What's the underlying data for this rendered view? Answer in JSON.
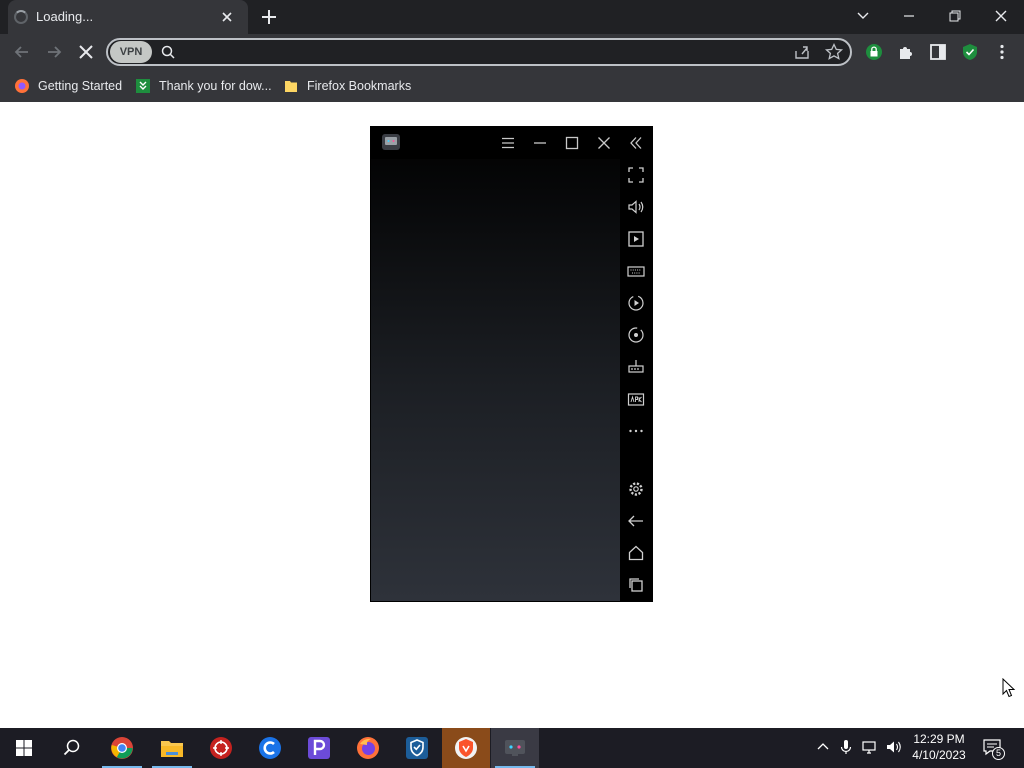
{
  "browser": {
    "tab_title": "Loading...",
    "vpn_label": "VPN",
    "omnibox_placeholder": "",
    "bookmarks": [
      {
        "label": "Getting Started",
        "icon": "firefox-icon"
      },
      {
        "label": "Thank you for dow...",
        "icon": "download-site-icon"
      },
      {
        "label": "Firefox Bookmarks",
        "icon": "folder-icon"
      }
    ],
    "colors": {
      "frame": "#202124",
      "toolbar": "#35363a",
      "accent_green": "#1e8e3e"
    }
  },
  "emulator": {
    "toolbar_icons": [
      "menu-icon",
      "minimize-icon",
      "maximize-icon",
      "close-icon",
      "collapse-icon"
    ],
    "side_icons": [
      "fullscreen-icon",
      "volume-icon",
      "screen-record-icon",
      "keyboard-icon",
      "macro-icon",
      "rotate-icon",
      "install-apk-icon",
      "apk-icon",
      "more-icon",
      "settings-icon",
      "back-icon",
      "home-icon",
      "recents-icon"
    ]
  },
  "taskbar": {
    "apps": [
      "start-icon",
      "search-icon",
      "chrome-icon",
      "file-explorer-icon",
      "app-red-icon",
      "ccleaner-icon",
      "pdf-app-icon",
      "firefox-icon",
      "shield-app-icon",
      "brave-icon",
      "emulator-icon"
    ],
    "time": "12:29 PM",
    "date": "4/10/2023",
    "notification_count": "5"
  }
}
